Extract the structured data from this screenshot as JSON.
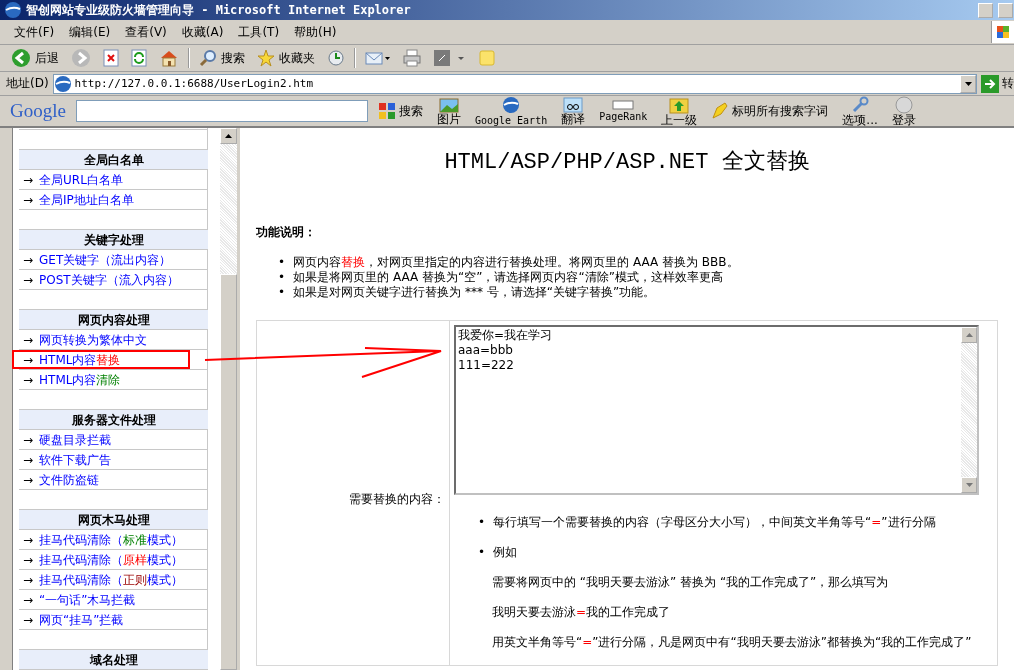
{
  "window": {
    "title": "智创网站专业级防火墙管理向导 - Microsoft Internet Explorer"
  },
  "menu": [
    {
      "label": "文件(F)"
    },
    {
      "label": "编辑(E)"
    },
    {
      "label": "查看(V)"
    },
    {
      "label": "收藏(A)"
    },
    {
      "label": "工具(T)"
    },
    {
      "label": "帮助(H)"
    }
  ],
  "toolbar": [
    {
      "kind": "back",
      "label": "后退"
    },
    {
      "kind": "forward"
    },
    {
      "kind": "stop"
    },
    {
      "kind": "refresh"
    },
    {
      "kind": "home"
    },
    {
      "kind": "search",
      "label": "搜索"
    },
    {
      "kind": "favorites",
      "label": "收藏夹"
    },
    {
      "kind": "history"
    },
    {
      "kind": "mail"
    },
    {
      "kind": "print"
    },
    {
      "kind": "edit"
    },
    {
      "kind": "note"
    }
  ],
  "address": {
    "label": "地址(D)",
    "value": "http://127.0.0.1:6688/UserLogin2.htm",
    "go": "转"
  },
  "google_bar": {
    "logo": "Google",
    "search": "搜索",
    "buttons": [
      {
        "kind": "images",
        "label": "图片"
      },
      {
        "kind": "earth",
        "label": "Google Earth"
      },
      {
        "kind": "translate",
        "label": "翻译"
      },
      {
        "kind": "pagerank",
        "label": "PageRank"
      },
      {
        "kind": "up",
        "label": "上一级"
      },
      {
        "kind": "highlight",
        "label": "标明所有搜索字词"
      },
      {
        "kind": "options",
        "label": "选项..."
      },
      {
        "kind": "login",
        "label": "登录"
      }
    ]
  },
  "sidebar": [
    {
      "title": "全局白名单",
      "items": [
        {
          "marker": "→",
          "parts": [
            {
              "text": "全局URL白名单"
            }
          ]
        },
        {
          "marker": "→",
          "parts": [
            {
              "text": "全局IP地址白名单"
            }
          ]
        }
      ]
    },
    {
      "title": "关键字处理",
      "items": [
        {
          "marker": "→",
          "parts": [
            {
              "text": "GET关键字（流出内容）"
            }
          ]
        },
        {
          "marker": "→",
          "parts": [
            {
              "text": "POST关键字（流入内容）"
            }
          ]
        }
      ]
    },
    {
      "title": "网页内容处理",
      "items": [
        {
          "marker": "→",
          "parts": [
            {
              "text": "网页转换为繁体中文"
            }
          ]
        },
        {
          "marker": "→",
          "parts": [
            {
              "text": "HTML内容"
            },
            {
              "text": "替换",
              "kind": "alert"
            }
          ]
        },
        {
          "marker": "→",
          "parts": [
            {
              "text": "HTML内容"
            },
            {
              "text": "清除",
              "kind": "ok"
            }
          ]
        }
      ]
    },
    {
      "title": "服务器文件处理",
      "items": [
        {
          "marker": "→",
          "parts": [
            {
              "text": "硬盘目录拦截"
            }
          ]
        },
        {
          "marker": "→",
          "parts": [
            {
              "text": "软件下载广告"
            }
          ]
        },
        {
          "marker": "→",
          "parts": [
            {
              "text": "文件防盗链"
            }
          ]
        }
      ]
    },
    {
      "title": "网页木马处理",
      "items": [
        {
          "marker": "→",
          "parts": [
            {
              "text": "挂马代码清除（"
            },
            {
              "text": "标准",
              "kind": "ok"
            },
            {
              "text": "模式）"
            }
          ]
        },
        {
          "marker": "→",
          "parts": [
            {
              "text": "挂马代码清除（"
            },
            {
              "text": "原样",
              "kind": "alert"
            },
            {
              "text": "模式）"
            }
          ]
        },
        {
          "marker": "→",
          "parts": [
            {
              "text": "挂马代码清除（"
            },
            {
              "text": "正则",
              "kind": "rule"
            },
            {
              "text": "模式）"
            }
          ]
        },
        {
          "marker": "→",
          "parts": [
            {
              "text": "“一句话”木马拦截"
            }
          ]
        },
        {
          "marker": "→",
          "parts": [
            {
              "text": "网页“挂马”拦截"
            }
          ]
        }
      ]
    },
    {
      "title": "域名处理"
    }
  ],
  "main": {
    "title": "HTML/ASP/PHP/ASP.NET 全文替换",
    "section_label": "功能说明：",
    "notes": [
      {
        "bullet": "•",
        "parts": [
          {
            "text": "网页内容"
          },
          {
            "text": "替换",
            "kind": "alert"
          },
          {
            "text": "，对网页里指定的内容进行替换处理。将网页里的 AAA 替换为 BBB。"
          }
        ]
      },
      {
        "bullet": "•",
        "parts": [
          {
            "text": "如果是将网页里的 AAA 替换为“空”，请选择网页内容“清除”模式，这样效率更高"
          }
        ]
      },
      {
        "bullet": "•",
        "parts": [
          {
            "text": "如果是对网页关键字进行替换为 *** 号，请选择“关键字替换”功能。"
          }
        ]
      }
    ],
    "form_label": "需要替换的内容：",
    "textarea": "我爱你=我在学习\naaa=bbb\n111=222",
    "hints": [
      {
        "bullet": "•",
        "parts": [
          {
            "text": "每行填写一个需要替换的内容（字母区分大小写），中间英文半角等号“"
          },
          {
            "text": "=",
            "kind": "alert"
          },
          {
            "text": "”进行分隔"
          }
        ]
      },
      {
        "bullet": "•",
        "parts": [
          {
            "text": "例如"
          }
        ]
      }
    ],
    "examples": [
      [
        {
          "text": "需要将网页中的 “我明天要去游泳” 替换为 “我的工作完成了”，那么填写为"
        }
      ],
      [
        {
          "text": "我明天要去游泳"
        },
        {
          "text": "=",
          "kind": "alert"
        },
        {
          "text": "我的工作完成了"
        }
      ],
      [
        {
          "text": "用英文半角等号“"
        },
        {
          "text": "=",
          "kind": "alert"
        },
        {
          "text": "”进行分隔，凡是网页中有“我明天要去游泳”都替换为“我的工作完成了”"
        }
      ]
    ]
  }
}
